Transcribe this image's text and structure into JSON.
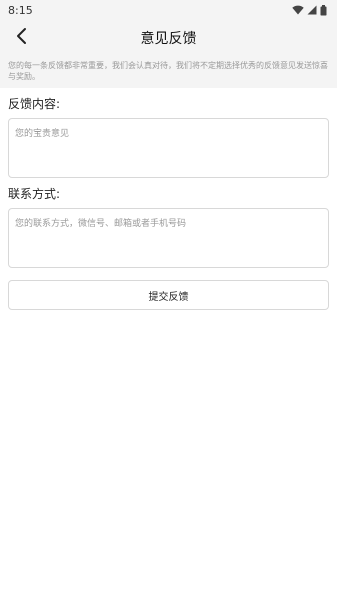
{
  "status_bar": {
    "time": "8:15",
    "icons": [
      "wifi-icon",
      "signal-icon",
      "battery-icon"
    ]
  },
  "app_bar": {
    "back_icon": "chevron-left-icon",
    "title": "意见反馈"
  },
  "intro_text": "您的每一条反馈都非常重要，我们会认真对待，我们将不定期选择优秀的反馈意见发送惊喜与奖励。",
  "feedback": {
    "label": "反馈内容:",
    "placeholder": "您的宝贵意见",
    "value": ""
  },
  "contact": {
    "label": "联系方式:",
    "placeholder": "您的联系方式，微信号、邮箱或者手机号码",
    "value": ""
  },
  "submit_label": "提交反馈",
  "colors": {
    "header_bg": "#f4f4f4",
    "border": "#d8d8d8",
    "hint_text": "#999999"
  }
}
